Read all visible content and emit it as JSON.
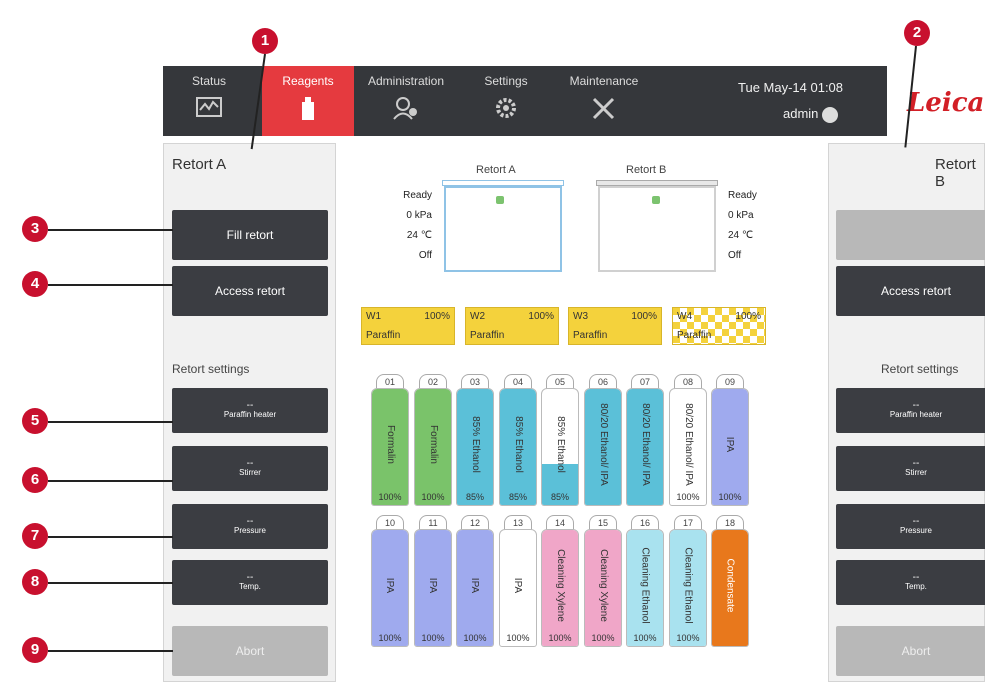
{
  "nav": {
    "tabs": [
      {
        "label": "Status",
        "icon": "status-icon"
      },
      {
        "label": "Reagents",
        "icon": "reagents-icon"
      },
      {
        "label": "Administration",
        "icon": "administration-icon"
      },
      {
        "label": "Settings",
        "icon": "gear-icon"
      },
      {
        "label": "Maintenance",
        "icon": "tools-icon"
      }
    ],
    "active_tab": "Reagents",
    "datetime": "Tue May-14 01:08",
    "user": "admin",
    "logo": "Leica"
  },
  "left_panel": {
    "title": "Retort A",
    "fill_button": "Fill retort",
    "access_button": "Access retort",
    "settings_label": "Retort settings",
    "paraffin_heater": {
      "value": "--",
      "label": "Paraffin heater"
    },
    "stirrer": {
      "value": "--",
      "label": "Stirrer"
    },
    "pressure": {
      "value": "--",
      "label": "Pressure"
    },
    "temp": {
      "value": "--",
      "label": "Temp."
    },
    "abort_button": "Abort"
  },
  "right_panel": {
    "title": "Retort B",
    "access_button": "Access retort",
    "settings_label": "Retort settings",
    "paraffin_heater": {
      "value": "--",
      "label": "Paraffin heater"
    },
    "stirrer": {
      "value": "--",
      "label": "Stirrer"
    },
    "pressure": {
      "value": "--",
      "label": "Pressure"
    },
    "temp": {
      "value": "--",
      "label": "Temp."
    },
    "abort_button": "Abort"
  },
  "retorts": {
    "a": {
      "label": "Retort A",
      "status": "Ready",
      "pressure": "0 kPa",
      "temp": "24 ℃",
      "state": "Off"
    },
    "b": {
      "label": "Retort B",
      "status": "Ready",
      "pressure": "0 kPa",
      "temp": "24 ℃",
      "state": "Off"
    }
  },
  "wax_baths": [
    {
      "id": "W1",
      "percent": "100%",
      "reagent": "Paraffin"
    },
    {
      "id": "W2",
      "percent": "100%",
      "reagent": "Paraffin"
    },
    {
      "id": "W3",
      "percent": "100%",
      "reagent": "Paraffin"
    },
    {
      "id": "W4",
      "percent": "100%",
      "reagent": "Paraffin"
    }
  ],
  "bottles": [
    {
      "id": "01",
      "name": "Formalin",
      "percent": "100%",
      "fill": 1.0,
      "color": "#7ac36a"
    },
    {
      "id": "02",
      "name": "Formalin",
      "percent": "100%",
      "fill": 1.0,
      "color": "#7ac36a"
    },
    {
      "id": "03",
      "name": "85% Ethanol",
      "percent": "85%",
      "fill": 1.0,
      "color": "#5bc0d8"
    },
    {
      "id": "04",
      "name": "85% Ethanol",
      "percent": "85%",
      "fill": 1.0,
      "color": "#5bc0d8"
    },
    {
      "id": "05",
      "name": "85% Ethanol",
      "percent": "85%",
      "fill": 0.35,
      "color": "#5bc0d8"
    },
    {
      "id": "06",
      "name": "80/20 Ethanol/ IPA",
      "percent": "",
      "fill": 1.0,
      "color": "#5bc0d8"
    },
    {
      "id": "07",
      "name": "80/20 Ethanol/ IPA",
      "percent": "",
      "fill": 1.0,
      "color": "#5bc0d8"
    },
    {
      "id": "08",
      "name": "80/20 Ethanol/ IPA",
      "percent": "100%",
      "fill": 0.0,
      "color": "#5bc0d8"
    },
    {
      "id": "09",
      "name": "IPA",
      "percent": "100%",
      "fill": 1.0,
      "color": "#9faaee"
    },
    {
      "id": "10",
      "name": "IPA",
      "percent": "100%",
      "fill": 1.0,
      "color": "#9faaee"
    },
    {
      "id": "11",
      "name": "IPA",
      "percent": "100%",
      "fill": 1.0,
      "color": "#9faaee"
    },
    {
      "id": "12",
      "name": "IPA",
      "percent": "100%",
      "fill": 1.0,
      "color": "#9faaee"
    },
    {
      "id": "13",
      "name": "IPA",
      "percent": "100%",
      "fill": 0.0,
      "color": "#9faaee"
    },
    {
      "id": "14",
      "name": "Cleaning Xylene",
      "percent": "100%",
      "fill": 1.0,
      "color": "#f0a6c8"
    },
    {
      "id": "15",
      "name": "Cleaning Xylene",
      "percent": "100%",
      "fill": 1.0,
      "color": "#f0a6c8"
    },
    {
      "id": "16",
      "name": "Cleaning Ethanol",
      "percent": "100%",
      "fill": 1.0,
      "color": "#a9e2ef"
    },
    {
      "id": "17",
      "name": "Cleaning Ethanol",
      "percent": "100%",
      "fill": 1.0,
      "color": "#a9e2ef"
    },
    {
      "id": "18",
      "name": "Condensate",
      "percent": "",
      "fill": 1.0,
      "color": "#e8781c"
    }
  ],
  "callouts": [
    "1",
    "2",
    "3",
    "4",
    "5",
    "6",
    "7",
    "8",
    "9"
  ]
}
